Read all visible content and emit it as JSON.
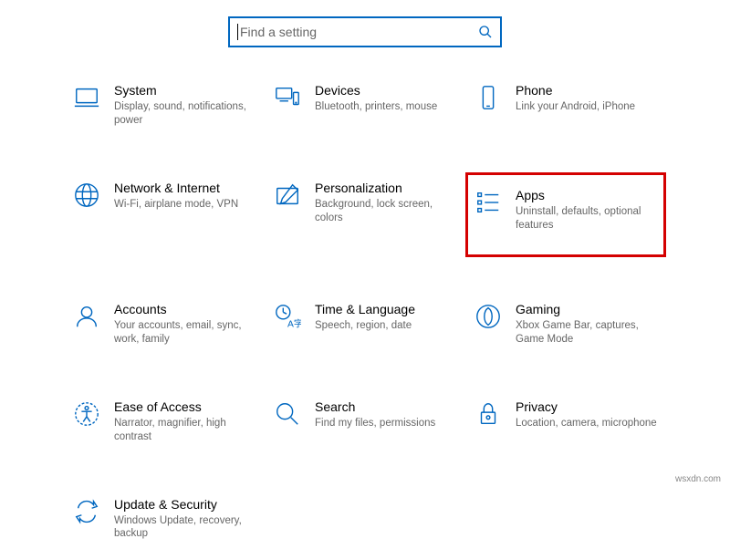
{
  "search": {
    "placeholder": "Find a setting"
  },
  "tiles": {
    "system": {
      "title": "System",
      "desc": "Display, sound, notifications, power"
    },
    "devices": {
      "title": "Devices",
      "desc": "Bluetooth, printers, mouse"
    },
    "phone": {
      "title": "Phone",
      "desc": "Link your Android, iPhone"
    },
    "network": {
      "title": "Network & Internet",
      "desc": "Wi-Fi, airplane mode, VPN"
    },
    "personalization": {
      "title": "Personalization",
      "desc": "Background, lock screen, colors"
    },
    "apps": {
      "title": "Apps",
      "desc": "Uninstall, defaults, optional features"
    },
    "accounts": {
      "title": "Accounts",
      "desc": "Your accounts, email, sync, work, family"
    },
    "time": {
      "title": "Time & Language",
      "desc": "Speech, region, date"
    },
    "gaming": {
      "title": "Gaming",
      "desc": "Xbox Game Bar, captures, Game Mode"
    },
    "ease": {
      "title": "Ease of Access",
      "desc": "Narrator, magnifier, high contrast"
    },
    "searchcat": {
      "title": "Search",
      "desc": "Find my files, permissions"
    },
    "privacy": {
      "title": "Privacy",
      "desc": "Location, camera, microphone"
    },
    "update": {
      "title": "Update & Security",
      "desc": "Windows Update, recovery, backup"
    }
  },
  "attribution": "wsxdn.com"
}
